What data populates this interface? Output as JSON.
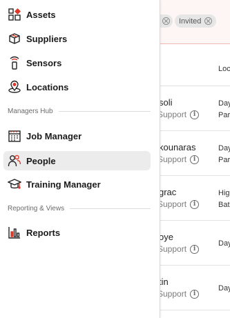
{
  "filters": {
    "chips": [
      "Invited"
    ]
  },
  "table": {
    "column_header": "Loc",
    "rows": [
      {
        "name": "soli",
        "role": "Support",
        "loc1": "Day",
        "loc2": "Par"
      },
      {
        "name": "kounaras",
        "role": "Support",
        "loc1": "Day",
        "loc2": "Par"
      },
      {
        "name": "grac",
        "role": "Support",
        "loc1": "Hig",
        "loc2": "Bat"
      },
      {
        "name": "oye",
        "role": "Support",
        "loc1": "Day",
        "loc2": ""
      },
      {
        "name": "tin",
        "role": "Support",
        "loc1": "Day",
        "loc2": ""
      }
    ]
  },
  "sidebar": {
    "items_top": [
      {
        "label": "Assets",
        "icon": "assets-icon"
      },
      {
        "label": "Suppliers",
        "icon": "suppliers-icon"
      },
      {
        "label": "Sensors",
        "icon": "sensors-icon"
      },
      {
        "label": "Locations",
        "icon": "locations-icon"
      }
    ],
    "section_managers": "Managers Hub",
    "items_managers": [
      {
        "label": "Job Manager",
        "icon": "job-manager-icon"
      },
      {
        "label": "People",
        "icon": "people-icon",
        "active": true
      },
      {
        "label": "Training Manager",
        "icon": "training-manager-icon"
      }
    ],
    "section_reporting": "Reporting & Views",
    "items_reporting": [
      {
        "label": "Reports",
        "icon": "reports-icon"
      }
    ]
  },
  "colors": {
    "accent_red": "#d93a2b",
    "active_bg": "#ececec"
  }
}
